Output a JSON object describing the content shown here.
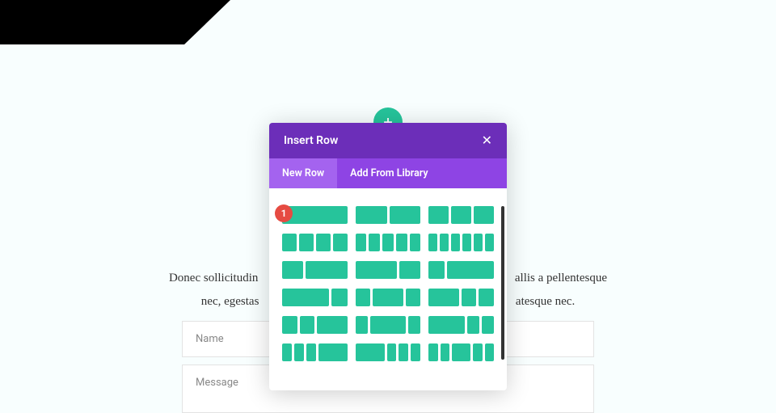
{
  "add_icon": "+",
  "background": {
    "text_line1": "Donec sollicitudin",
    "text_line1_right": "allis a pellentesque",
    "text_line2": "nec, egestas",
    "text_line2_right": "atesque nec.",
    "name_placeholder": "Name",
    "message_placeholder": "Message"
  },
  "modal": {
    "title": "Insert Row",
    "close": "✕",
    "tabs": {
      "new_row": "New Row",
      "add_from_library": "Add From Library"
    }
  },
  "annotation": {
    "number": "1"
  }
}
